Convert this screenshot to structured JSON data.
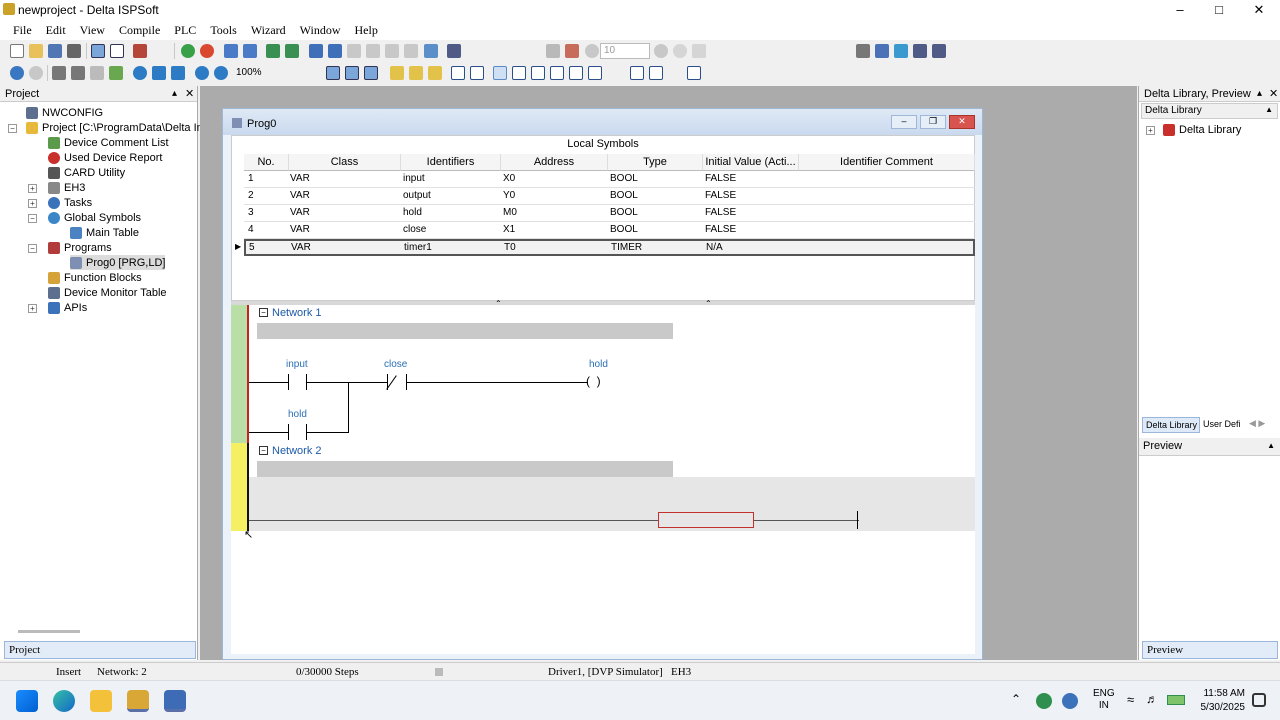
{
  "window": {
    "title": "newproject - Delta ISPSoft"
  },
  "menu": [
    "File",
    "Edit",
    "View",
    "Compile",
    "PLC",
    "Tools",
    "Wizard",
    "Window",
    "Help"
  ],
  "toolbar": {
    "zoom": "100%",
    "steps_value": "10"
  },
  "project_panel": {
    "title": "Project",
    "bottom_tab": "Project",
    "items": [
      "NWCONFIG",
      "Project [C:\\ProgramData\\Delta Inc",
      "Device Comment List",
      "Used Device Report",
      "CARD Utility",
      "EH3",
      "Tasks",
      "Global Symbols",
      "Main Table",
      "Programs",
      "Prog0 [PRG,LD]",
      "Function Blocks",
      "Device Monitor Table",
      "APIs"
    ]
  },
  "prog_window": {
    "title": "Prog0",
    "symbols_title": "Local Symbols"
  },
  "symbol_table": {
    "columns": [
      "No.",
      "Class",
      "Identifiers",
      "Address",
      "Type",
      "Initial Value (Acti...",
      "Identifier Comment"
    ],
    "rows": [
      [
        "1",
        "VAR",
        "input",
        "X0",
        "BOOL",
        "FALSE",
        ""
      ],
      [
        "2",
        "VAR",
        "output",
        "Y0",
        "BOOL",
        "FALSE",
        ""
      ],
      [
        "3",
        "VAR",
        "hold",
        "M0",
        "BOOL",
        "FALSE",
        ""
      ],
      [
        "4",
        "VAR",
        "close",
        "X1",
        "BOOL",
        "FALSE",
        ""
      ],
      [
        "5",
        "VAR",
        "timer1",
        "T0",
        "TIMER",
        "N/A",
        ""
      ]
    ]
  },
  "ladder": {
    "network1": "Network 1",
    "network2": "Network 2",
    "contact_input": "input",
    "contact_close": "close",
    "coil_hold": "hold",
    "contact_hold": "hold"
  },
  "library_panel": {
    "title": "Delta Library, Preview",
    "dropdown": "Delta Library",
    "tree_root": "Delta Library",
    "tab1": "Delta Library",
    "tab2": "User Defi",
    "preview": "Preview",
    "bottom_tab": "Preview"
  },
  "status": {
    "mode": "Insert",
    "network": "Network: 2",
    "steps": "0/30000 Steps",
    "driver": "Driver1, [DVP Simulator]",
    "plc": "EH3"
  },
  "taskbar": {
    "lang1": "ENG",
    "lang2": "IN",
    "time": "11:58 AM",
    "date": "5/30/2025"
  }
}
